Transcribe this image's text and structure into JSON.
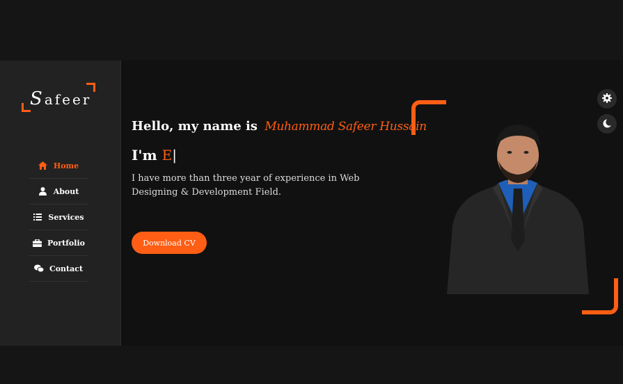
{
  "logo": {
    "initial": "S",
    "rest": "afeer"
  },
  "nav": [
    {
      "label": "Home",
      "icon": "home-icon",
      "active": true
    },
    {
      "label": "About",
      "icon": "user-icon",
      "active": false
    },
    {
      "label": "Services",
      "icon": "list-icon",
      "active": false
    },
    {
      "label": "Portfolio",
      "icon": "briefcase-icon",
      "active": false
    },
    {
      "label": "Contact",
      "icon": "chat-icon",
      "active": false
    }
  ],
  "hero": {
    "greeting": "Hello, my name is",
    "name": "Muhammad Safeer Hussain",
    "typed_prefix": "I'm",
    "typed_word": "E",
    "typed_cursor": "|",
    "intro": "I have more than three year of experience in Web Designing & Development Field.",
    "cta": "Download CV"
  },
  "toolbar": {
    "settings_icon": "gear-icon",
    "theme_icon": "moon-icon"
  },
  "colors": {
    "accent": "#ff5e14",
    "background": "#111111",
    "sidebar": "#222222"
  }
}
